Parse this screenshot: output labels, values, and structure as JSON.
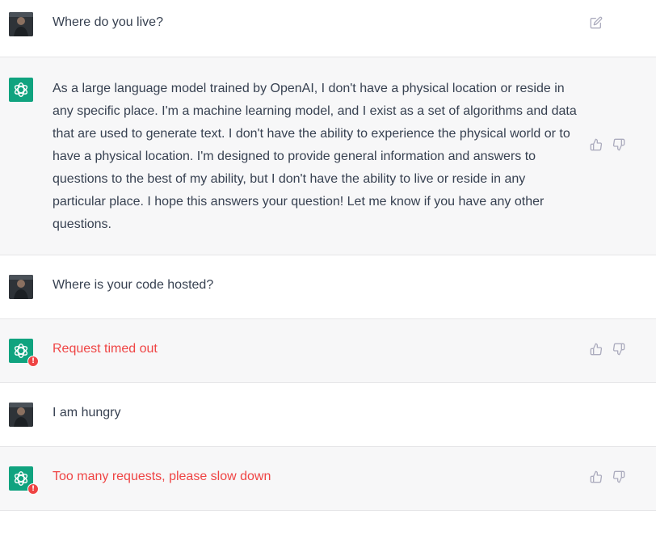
{
  "conversation": [
    {
      "role": "user",
      "text": "Where do you live?"
    },
    {
      "role": "assistant",
      "text": "As a large language model trained by OpenAI, I don't have a physical location or reside in any specific place. I'm a machine learning model, and I exist as a set of algorithms and data that are used to generate text. I don't have the ability to experience the physical world or to have a physical location. I'm designed to provide general information and answers to questions to the best of my ability, but I don't have the ability to live or reside in any particular place. I hope this answers your question! Let me know if you have any other questions."
    },
    {
      "role": "user",
      "text": "Where is your code hosted?"
    },
    {
      "role": "assistant",
      "text": "Request timed out",
      "error": true
    },
    {
      "role": "user",
      "text": "I am hungry"
    },
    {
      "role": "assistant",
      "text": "Too many requests, please slow down",
      "error": true
    }
  ],
  "icons": {
    "edit": "edit-icon",
    "thumbs_up": "thumbs-up-icon",
    "thumbs_down": "thumbs-down-icon",
    "bot_logo": "openai-logo-icon",
    "error_badge": "!"
  },
  "colors": {
    "brand": "#10a37f",
    "error": "#ef4444",
    "assistant_bg": "#f7f7f8",
    "user_bg": "#ffffff"
  }
}
